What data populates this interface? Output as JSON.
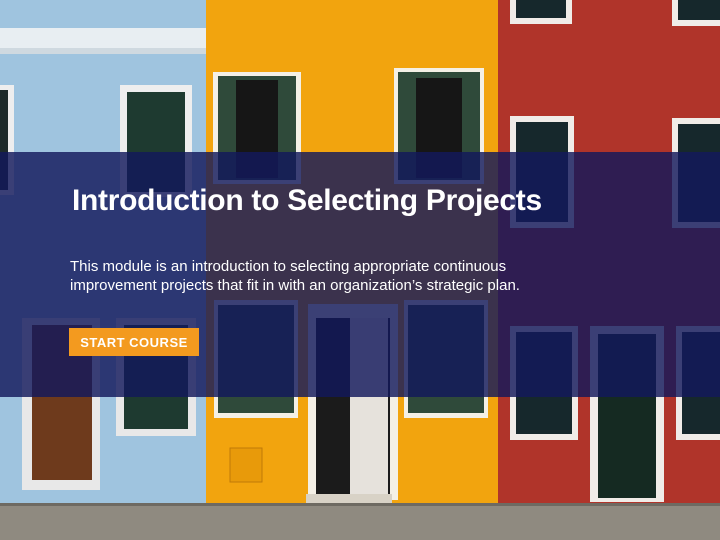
{
  "hero": {
    "title": "Introduction to Selecting Projects",
    "description": "This module is an introduction to selecting appropriate continuous improvement projects that fit in with an organization’s strategic plan.",
    "start_button_label": "START COURSE"
  },
  "colors": {
    "overlay": "#12185c",
    "button": "#f39a1f",
    "wall_blue": "#9fc4df",
    "wall_yellow": "#f2a40e",
    "wall_red": "#b0342a"
  }
}
